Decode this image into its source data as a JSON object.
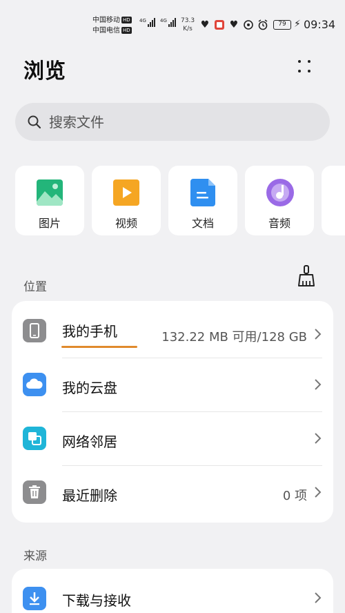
{
  "status_bar": {
    "carrier_1": "中国移动",
    "carrier_2": "中国电信",
    "hd_label": "HD",
    "net_type": "4G",
    "net_type_2": "4G",
    "speed_value": "73.3",
    "speed_unit": "K/s",
    "battery": "79",
    "time": "09:34"
  },
  "header": {
    "title": "浏览"
  },
  "search": {
    "placeholder": "搜索文件"
  },
  "categories": [
    {
      "label": "图片",
      "icon": "image-icon",
      "color": "#23b57a"
    },
    {
      "label": "视频",
      "icon": "video-icon",
      "color": "#f5a623"
    },
    {
      "label": "文档",
      "icon": "document-icon",
      "color": "#2f8ff0"
    },
    {
      "label": "音频",
      "icon": "music-icon",
      "color": "#9a6ae6"
    }
  ],
  "location": {
    "section_label": "位置",
    "items": [
      {
        "label": "我的手机",
        "value": "132.22 MB 可用/128 GB",
        "icon": "phone-icon"
      },
      {
        "label": "我的云盘",
        "value": "",
        "icon": "cloud-icon"
      },
      {
        "label": "网络邻居",
        "value": "",
        "icon": "network-icon"
      },
      {
        "label": "最近删除",
        "value": "0 项",
        "icon": "trash-icon"
      }
    ]
  },
  "source": {
    "section_label": "来源",
    "items": [
      {
        "label": "下载与接收",
        "icon": "download-icon"
      }
    ]
  }
}
